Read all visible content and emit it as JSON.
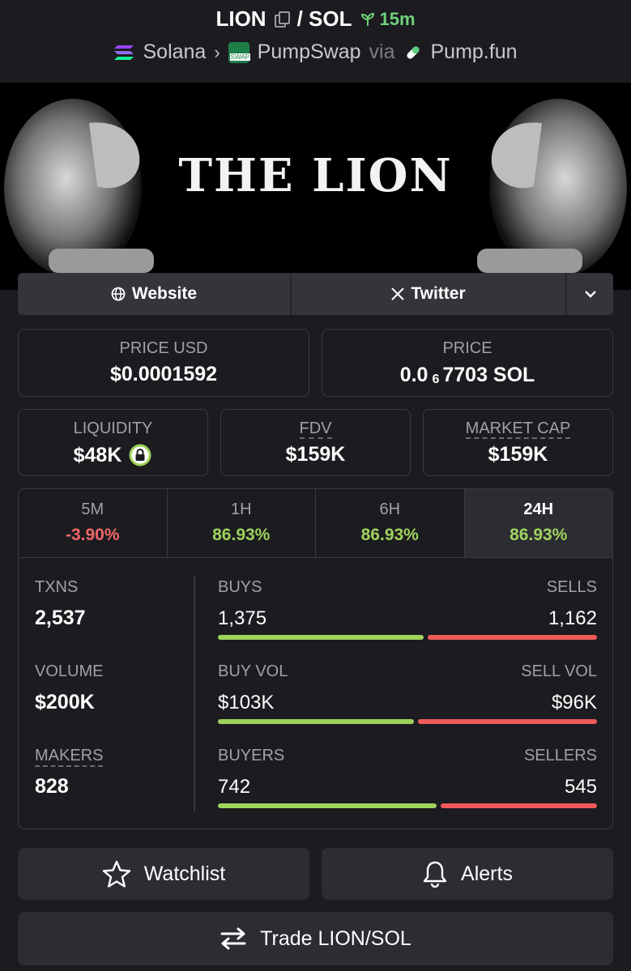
{
  "header": {
    "base_token": "LION",
    "quote_token": "/ SOL",
    "age": "15m",
    "chain": "Solana",
    "dex": "PumpSwap",
    "via": "via",
    "launchpad": "Pump.fun"
  },
  "banner": {
    "title": "THE LION"
  },
  "links": {
    "website": "Website",
    "twitter": "Twitter"
  },
  "prices": {
    "usd_label": "PRICE USD",
    "usd_value": "$0.0001592",
    "native_label": "PRICE",
    "native_prefix": "0.0",
    "native_sub": "6",
    "native_rest": "7703 SOL"
  },
  "metrics": {
    "liquidity_label": "LIQUIDITY",
    "liquidity_value": "$48K",
    "fdv_label": "FDV",
    "fdv_value": "$159K",
    "mcap_label": "MARKET CAP",
    "mcap_value": "$159K"
  },
  "tabs": [
    {
      "label": "5M",
      "change": "-3.90%"
    },
    {
      "label": "1H",
      "change": "86.93%"
    },
    {
      "label": "6H",
      "change": "86.93%"
    },
    {
      "label": "24H",
      "change": "86.93%"
    }
  ],
  "totals": {
    "txns_label": "TXNS",
    "txns_value": "2,537",
    "volume_label": "VOLUME",
    "volume_value": "$200K",
    "makers_label": "MAKERS",
    "makers_value": "828"
  },
  "breakdown": {
    "buys_label": "BUYS",
    "buys": "1,375",
    "sells_label": "SELLS",
    "sells": "1,162",
    "buy_vol_label": "BUY VOL",
    "buy_vol": "$103K",
    "sell_vol_label": "SELL VOL",
    "sell_vol": "$96K",
    "buyers_label": "BUYERS",
    "buyers": "742",
    "sellers_label": "SELLERS",
    "sellers": "545",
    "buys_ratio": 0.542,
    "buy_vol_ratio": 0.518,
    "buyers_ratio": 0.577
  },
  "actions": {
    "watchlist": "Watchlist",
    "alerts": "Alerts",
    "trade": "Trade LION/SOL"
  },
  "colors": {
    "positive": "#9fd35c",
    "negative": "#f06767",
    "age": "#6fd17a"
  }
}
